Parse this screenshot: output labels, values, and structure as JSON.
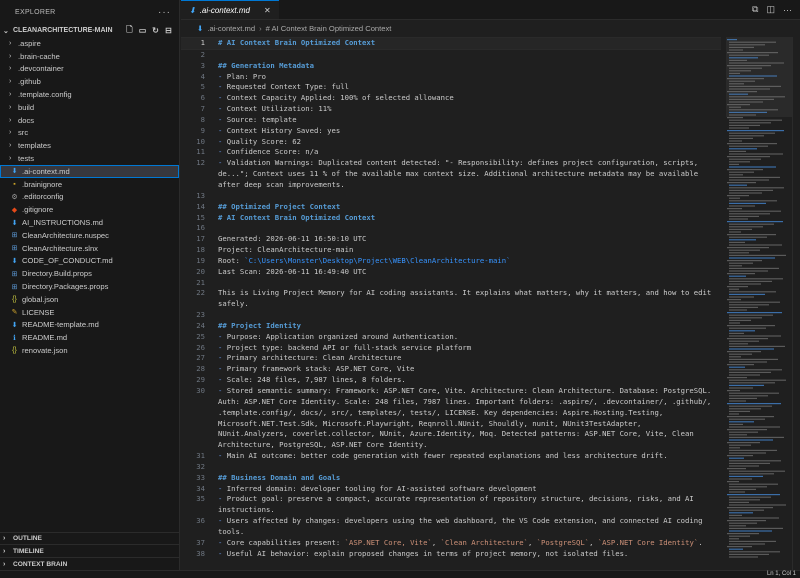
{
  "explorer": {
    "title": "EXPLORER",
    "more_icon": "ellipsis-icon",
    "root": "CLEANARCHITECTURE-MAIN",
    "items": [
      {
        "name": ".aspire",
        "type": "folder"
      },
      {
        "name": ".brain-cache",
        "type": "folder"
      },
      {
        "name": ".devcontainer",
        "type": "folder"
      },
      {
        "name": ".github",
        "type": "folder"
      },
      {
        "name": ".template.config",
        "type": "folder"
      },
      {
        "name": "build",
        "type": "folder"
      },
      {
        "name": "docs",
        "type": "folder"
      },
      {
        "name": "src",
        "type": "folder"
      },
      {
        "name": "templates",
        "type": "folder"
      },
      {
        "name": "tests",
        "type": "folder"
      },
      {
        "name": ".ai-context.md",
        "type": "md",
        "active": true
      },
      {
        "name": ".brainignore",
        "type": "config"
      },
      {
        "name": ".editorconfig",
        "type": "gear"
      },
      {
        "name": ".gitignore",
        "type": "git"
      },
      {
        "name": "AI_INSTRUCTIONS.md",
        "type": "md"
      },
      {
        "name": "CleanArchitecture.nuspec",
        "type": "xml"
      },
      {
        "name": "CleanArchitecture.slnx",
        "type": "xml"
      },
      {
        "name": "CODE_OF_CONDUCT.md",
        "type": "md"
      },
      {
        "name": "Directory.Build.props",
        "type": "xml"
      },
      {
        "name": "Directory.Packages.props",
        "type": "xml"
      },
      {
        "name": "global.json",
        "type": "json"
      },
      {
        "name": "LICENSE",
        "type": "license"
      },
      {
        "name": "README-template.md",
        "type": "md"
      },
      {
        "name": "README.md",
        "type": "info"
      },
      {
        "name": "renovate.json",
        "type": "json"
      }
    ],
    "panels": [
      "OUTLINE",
      "TIMELINE",
      "CONTEXT BRAIN"
    ]
  },
  "editor": {
    "tab_label": ".ai-context.md",
    "breadcrumb": [
      ".ai-context.md",
      "# AI Context Brain Optimized Context"
    ],
    "status_position": "Ln 1, Col 1"
  },
  "colors": {
    "heading": "#569cd6",
    "list_marker": "#6796e6",
    "link": "#3794ff",
    "inline_code": "#ce9178",
    "accent": "#0078d4"
  },
  "lines": [
    {
      "n": "1",
      "parts": [
        {
          "t": "# AI Context Brain Optimized Context",
          "c": "h"
        }
      ]
    },
    {
      "n": "2",
      "parts": []
    },
    {
      "n": "3",
      "parts": [
        {
          "t": "## Generation Metadata",
          "c": "h"
        }
      ]
    },
    {
      "n": "4",
      "parts": [
        {
          "t": "- ",
          "c": "li"
        },
        {
          "t": "Plan: Pro"
        }
      ]
    },
    {
      "n": "5",
      "parts": [
        {
          "t": "- ",
          "c": "li"
        },
        {
          "t": "Requested Context Type: full"
        }
      ]
    },
    {
      "n": "6",
      "parts": [
        {
          "t": "- ",
          "c": "li"
        },
        {
          "t": "Context Capacity Applied: 100% of selected allowance"
        }
      ]
    },
    {
      "n": "7",
      "parts": [
        {
          "t": "- ",
          "c": "li"
        },
        {
          "t": "Context Utilization: 11%"
        }
      ]
    },
    {
      "n": "8",
      "parts": [
        {
          "t": "- ",
          "c": "li"
        },
        {
          "t": "Source: template"
        }
      ]
    },
    {
      "n": "9",
      "parts": [
        {
          "t": "- ",
          "c": "li"
        },
        {
          "t": "Context History Saved: yes"
        }
      ]
    },
    {
      "n": "10",
      "parts": [
        {
          "t": "- ",
          "c": "li"
        },
        {
          "t": "Quality Score: 62"
        }
      ]
    },
    {
      "n": "11",
      "parts": [
        {
          "t": "- ",
          "c": "li"
        },
        {
          "t": "Confidence Score: n/a"
        }
      ]
    },
    {
      "n": "12",
      "parts": [
        {
          "t": "- ",
          "c": "li"
        },
        {
          "t": "Validation Warnings: Duplicated content detected: \"- Responsibility: defines project configuration, scripts, de...\"; Context uses 11 % of the available max context size. Additional architecture metadata may be available after deep scan improvements."
        }
      ]
    },
    {
      "n": "13",
      "parts": []
    },
    {
      "n": "14",
      "parts": [
        {
          "t": "## Optimized Project Context",
          "c": "h"
        }
      ]
    },
    {
      "n": "15",
      "parts": [
        {
          "t": "# AI Context Brain Optimized Context",
          "c": "h"
        }
      ]
    },
    {
      "n": "16",
      "parts": []
    },
    {
      "n": "17",
      "parts": [
        {
          "t": "Generated: 2026-06-11 16:50:10 UTC"
        }
      ]
    },
    {
      "n": "18",
      "parts": [
        {
          "t": "Project: CleanArchitecture-main"
        }
      ]
    },
    {
      "n": "19",
      "parts": [
        {
          "t": "Root: "
        },
        {
          "t": "`C:\\Users\\Monster\\Desktop\\Project\\WEB\\CleanArchitecture-main`",
          "c": "lnk"
        }
      ]
    },
    {
      "n": "20",
      "parts": [
        {
          "t": "Last Scan: 2026-06-11 16:49:40 UTC"
        }
      ]
    },
    {
      "n": "21",
      "parts": []
    },
    {
      "n": "22",
      "parts": [
        {
          "t": "This is Living Project Memory for AI coding assistants. It explains what matters, why it matters, and how to edit safely."
        }
      ]
    },
    {
      "n": "23",
      "parts": []
    },
    {
      "n": "24",
      "parts": [
        {
          "t": "## Project Identity",
          "c": "h"
        }
      ]
    },
    {
      "n": "25",
      "parts": [
        {
          "t": "- ",
          "c": "li"
        },
        {
          "t": "Purpose: Application organized around Authentication."
        }
      ]
    },
    {
      "n": "26",
      "parts": [
        {
          "t": "- ",
          "c": "li"
        },
        {
          "t": "Project type: backend API or full-stack service platform"
        }
      ]
    },
    {
      "n": "27",
      "parts": [
        {
          "t": "- ",
          "c": "li"
        },
        {
          "t": "Primary architecture: Clean Architecture"
        }
      ]
    },
    {
      "n": "28",
      "parts": [
        {
          "t": "- ",
          "c": "li"
        },
        {
          "t": "Primary framework stack: ASP.NET Core, Vite"
        }
      ]
    },
    {
      "n": "29",
      "parts": [
        {
          "t": "- ",
          "c": "li"
        },
        {
          "t": "Scale: 248 files, 7,987 lines, 8 folders."
        }
      ]
    },
    {
      "n": "30",
      "parts": [
        {
          "t": "- ",
          "c": "li"
        },
        {
          "t": "Stored semantic summary: Framework: ASP.NET Core, Vite. Architecture: Clean Architecture. Database: PostgreSQL. Auth: ASP.NET Core Identity. Scale: 248 files, 7987 lines. Important folders: .aspire/, .devcontainer/, .github/, .template.config/, docs/, src/, templates/, tests/, LICENSE. Key dependencies: Aspire.Hosting.Testing, Microsoft.NET.Test.Sdk, Microsoft.Playwright, Reqnroll.NUnit, Shouldly, nunit, NUnit3TestAdapter, NUnit.Analyzers, coverlet.collector, NUnit, Azure.Identity, Moq. Detected patterns: ASP.NET Core, Vite, Clean Architecture, PostgreSQL, ASP.NET Core Identity."
        }
      ]
    },
    {
      "n": "31",
      "parts": [
        {
          "t": "- ",
          "c": "li"
        },
        {
          "t": "Main AI outcome: better code generation with fewer repeated explanations and less architecture drift."
        }
      ]
    },
    {
      "n": "32",
      "parts": []
    },
    {
      "n": "33",
      "parts": [
        {
          "t": "## Business Domain and Goals",
          "c": "h"
        }
      ]
    },
    {
      "n": "34",
      "parts": [
        {
          "t": "- ",
          "c": "li"
        },
        {
          "t": "Inferred domain: developer tooling for AI-assisted software development"
        }
      ]
    },
    {
      "n": "35",
      "parts": [
        {
          "t": "- ",
          "c": "li"
        },
        {
          "t": "Product goal: preserve a compact, accurate representation of repository structure, decisions, risks, and AI instructions."
        }
      ]
    },
    {
      "n": "36",
      "parts": [
        {
          "t": "- ",
          "c": "li"
        },
        {
          "t": "Users affected by changes: developers using the web dashboard, the VS Code extension, and connected AI coding tools."
        }
      ]
    },
    {
      "n": "37",
      "parts": [
        {
          "t": "- ",
          "c": "li"
        },
        {
          "t": "Core capabilities present: "
        },
        {
          "t": "`ASP.NET Core, Vite`",
          "c": "inl"
        },
        {
          "t": ", "
        },
        {
          "t": "`Clean Architecture`",
          "c": "inl"
        },
        {
          "t": ", "
        },
        {
          "t": "`PostgreSQL`",
          "c": "inl"
        },
        {
          "t": ", "
        },
        {
          "t": "`ASP.NET Core Identity`",
          "c": "inl"
        },
        {
          "t": "."
        }
      ]
    },
    {
      "n": "38",
      "parts": [
        {
          "t": "- ",
          "c": "li"
        },
        {
          "t": "Useful AI behavior: explain proposed changes in terms of project memory, not isolated files."
        }
      ]
    }
  ]
}
